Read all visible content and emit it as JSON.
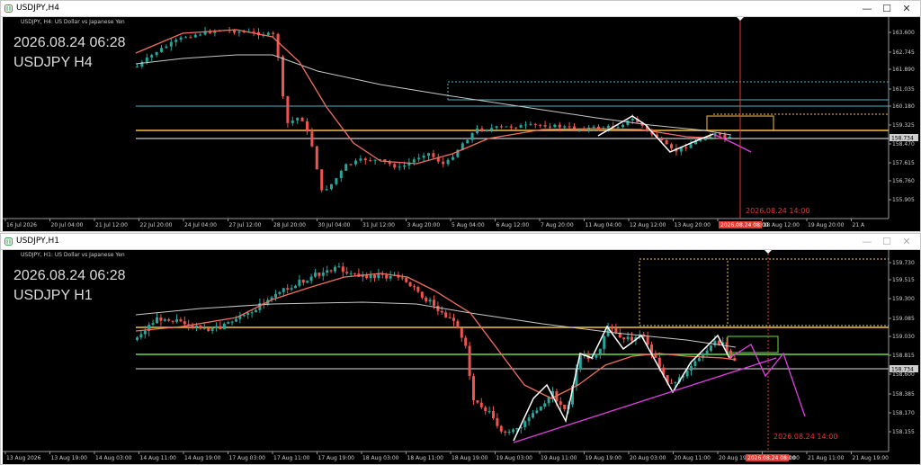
{
  "window1": {
    "title": "USDJPY,H4",
    "symbol_header": "USDJPY, H4:  US Dollar vs Japanese Yen",
    "overlay_time": "2026.08.24 06:28",
    "overlay_symbol": "USDJPY H4",
    "price_labels": [
      "163.600",
      "162.745",
      "161.890",
      "161.035",
      "160.180",
      "159.325",
      "158.470",
      "157.615",
      "156.760",
      "155.905"
    ],
    "current_price_tag": "158.734",
    "time_labels": [
      "16 Jul 2026",
      "20 Jul 04:00",
      "21 Jul 12:00",
      "22 Jul 20:00",
      "24 Jul 04:00",
      "27 Jul 12:00",
      "28 Jul 20:00",
      "30 Jul 04:00",
      "31 Jul 12:00",
      "3 Aug 20:00",
      "5 Aug 04:00",
      "6 Aug 12:00",
      "7 Aug 20:00",
      "11 Aug 04:00",
      "12 Aug 12:00",
      "13 Aug 20:00",
      "17 Aug 04:00",
      "18 Aug 12:00",
      "19 Aug 20:00",
      "21 A"
    ],
    "cursor_time_tag": "2026.08.24 08:00",
    "vline_label": "2026.08.24  14:00",
    "controls": {
      "minimize": "—",
      "maximize": "☐",
      "close": "✕"
    }
  },
  "window2": {
    "title": "USDJPY,H1",
    "symbol_header": "USDJPY, H1:  US Dollar vs Japanese Yen",
    "overlay_time": "2026.08.24 06:28",
    "overlay_symbol": "USDJPY H1",
    "price_labels": [
      "159.730",
      "159.515",
      "159.300",
      "159.085",
      "159.030",
      "158.815",
      "158.600",
      "158.385",
      "158.170",
      "158.155"
    ],
    "current_price_tag": "158.734",
    "time_labels": [
      "13 Aug 2026",
      "13 Aug 19:00",
      "14 Aug 03:00",
      "14 Aug 11:00",
      "14 Aug 19:00",
      "17 Aug 03:00",
      "17 Aug 11:00",
      "17 Aug 19:00",
      "18 Aug 03:00",
      "18 Aug 11:00",
      "18 Aug 19:00",
      "19 Aug 03:00",
      "19 Aug 11:00",
      "19 Aug 19:00",
      "20 Aug 03:00",
      "20 Aug 11:00",
      "20 Aug 19:00",
      "21 Aug 03:00",
      "21 Aug 11:00",
      "21 Aug 19:00"
    ],
    "cursor_time_tag": "2026.08.24 08:00",
    "vline_label": "2026.08.24  14:00",
    "controls": {
      "minimize": "—",
      "maximize": "☐",
      "close": "✕"
    }
  },
  "colors": {
    "bull": "#26a69a",
    "bear": "#ef5350",
    "ma_fast": "#f07060",
    "ma_slow": "#c8c8c8",
    "zigzag": "#ffffff",
    "projection": "#e040e0",
    "vline": "#e53935",
    "level_yellow": "#f5c242",
    "level_cyan": "#4fb3c8",
    "level_green": "#66dd44"
  }
}
